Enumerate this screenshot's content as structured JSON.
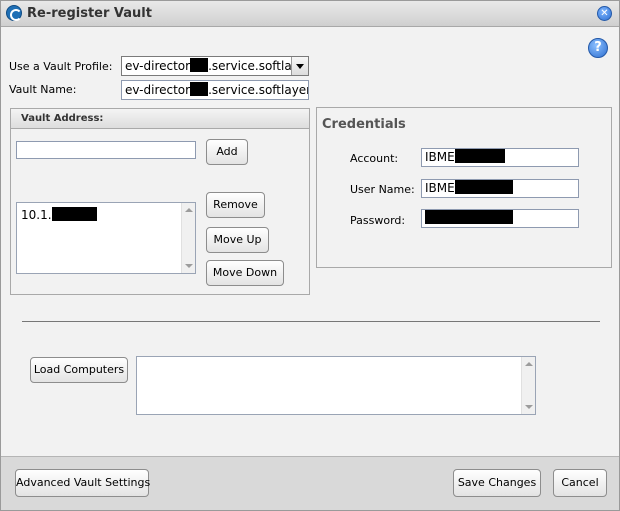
{
  "window": {
    "title": "Re-register Vault"
  },
  "form": {
    "profile_label": "Use a Vault Profile:",
    "profile_value_prefix": "ev-director",
    "profile_value_suffix": ".service.softla",
    "name_label": "Vault Name:",
    "name_value_prefix": "ev-director",
    "name_value_suffix": ".service.softlayer"
  },
  "vault_address": {
    "header": "Vault Address:",
    "input_value": "",
    "add_label": "Add",
    "items": [
      "10.1."
    ],
    "remove_label": "Remove",
    "move_up_label": "Move Up",
    "move_down_label": "Move Down"
  },
  "credentials": {
    "title": "Credentials",
    "account_label": "Account:",
    "account_value": "IBME",
    "username_label": "User Name:",
    "username_value": "IBME",
    "password_label": "Password:",
    "password_value": ""
  },
  "computers": {
    "load_label": "Load Computers",
    "list_value": ""
  },
  "footer": {
    "advanced_label": "Advanced Vault Settings",
    "save_label": "Save Changes",
    "cancel_label": "Cancel"
  },
  "icons": {
    "app": "app-logo-icon",
    "close": "close-icon",
    "help": "help-icon"
  },
  "colors": {
    "accent": "#2e6fd0",
    "titlebar": "#d8d8d8",
    "panel": "#f2f2f2"
  }
}
